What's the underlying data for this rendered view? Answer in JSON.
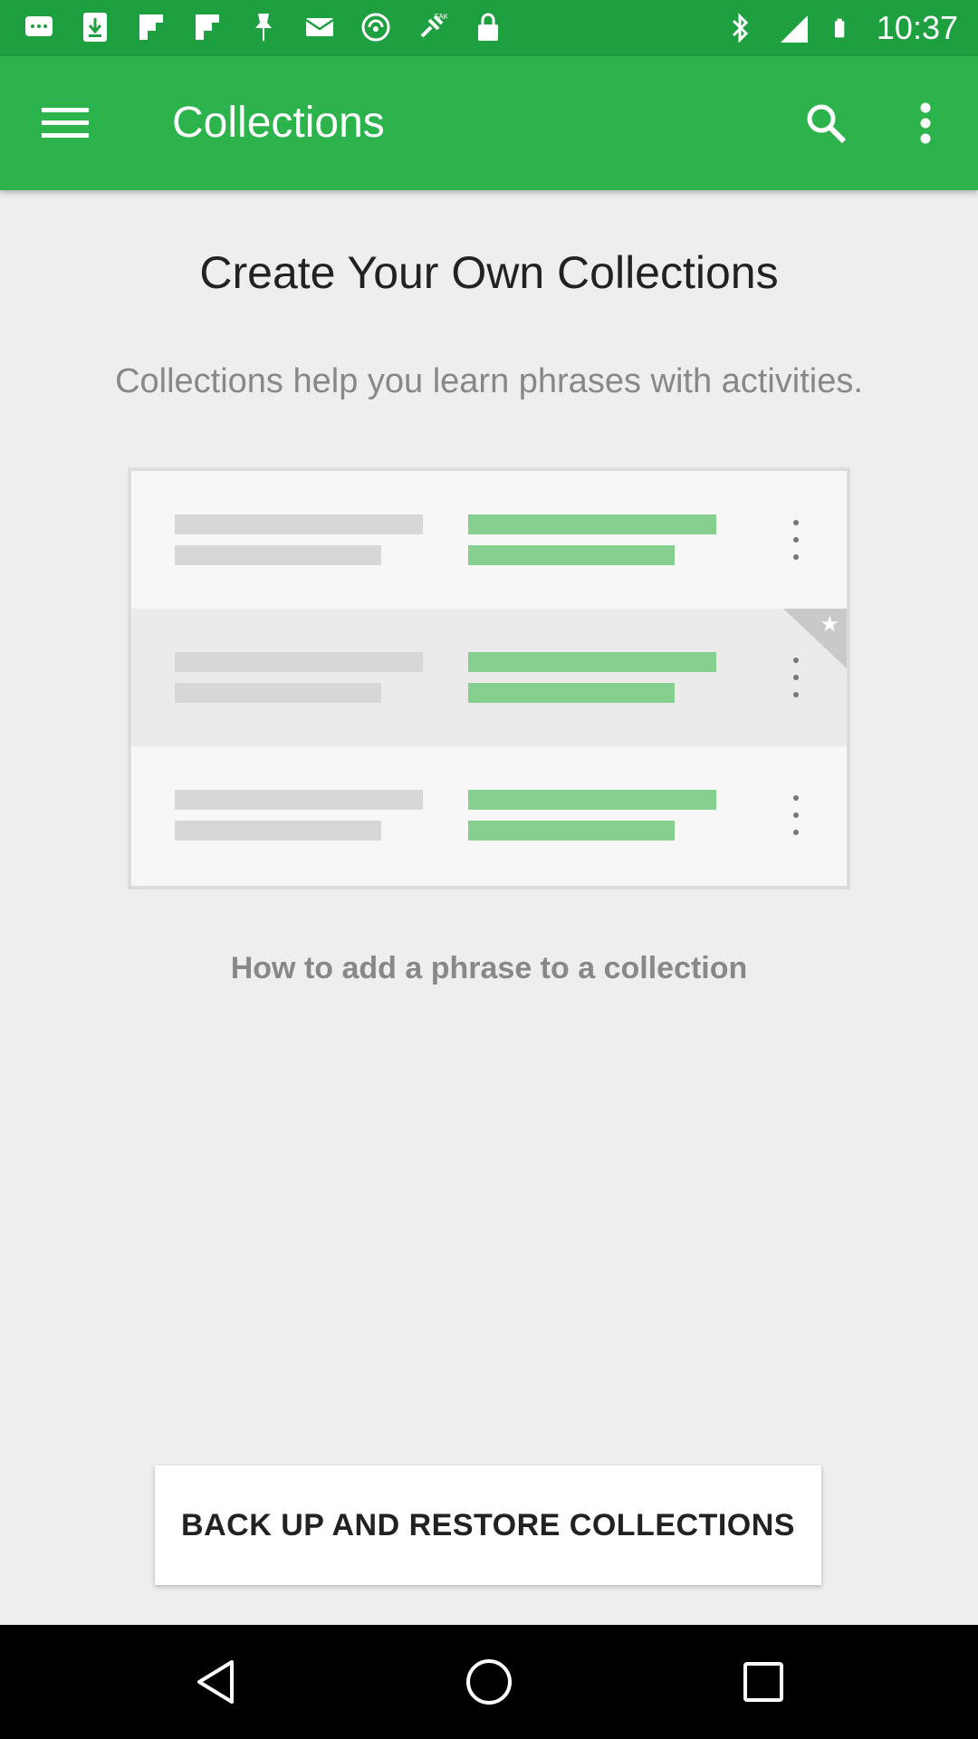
{
  "status_bar": {
    "time": "10:37",
    "icons_left": [
      "message-icon",
      "download-icon",
      "flipboard-icon",
      "flipboard-icon",
      "pin-icon",
      "mail-icon",
      "wifi-off-icon",
      "fake-gps-icon",
      "lock-icon"
    ],
    "icons_right": [
      "bluetooth-icon",
      "signal-icon",
      "battery-icon"
    ]
  },
  "app_bar": {
    "title": "Collections",
    "icons": [
      "menu-icon",
      "search-icon",
      "more-vert-icon"
    ],
    "color": "#2db34c"
  },
  "main": {
    "heading": "Create Your Own Collections",
    "subheading": "Collections help you learn phrases with activities.",
    "howto_link": "How to add a phrase to a collection",
    "backup_button": "BACK UP AND RESTORE COLLECTIONS"
  },
  "nav_bar": {
    "icons": [
      "back-icon",
      "home-icon",
      "recents-icon"
    ]
  }
}
